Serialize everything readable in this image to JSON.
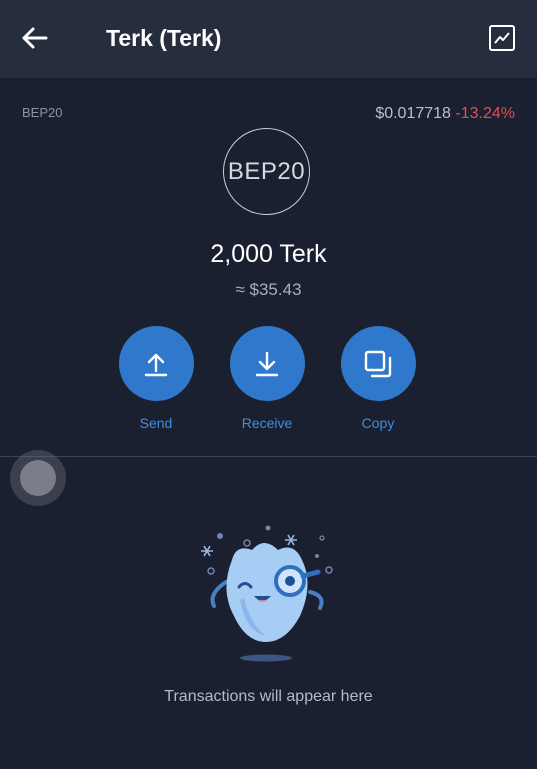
{
  "header": {
    "title": "Terk (Terk)",
    "back_icon": "arrow-left-icon",
    "chart_icon": "line-chart-icon"
  },
  "token": {
    "network": "BEP20",
    "logo_text": "BEP20",
    "price": "$0.017718",
    "change": "-13.24%",
    "balance": "2,000 Terk",
    "fiat_value": "≈ $35.43"
  },
  "actions": {
    "send": {
      "label": "Send",
      "icon": "upload-arrow-icon"
    },
    "receive": {
      "label": "Receive",
      "icon": "download-arrow-icon"
    },
    "copy": {
      "label": "Copy",
      "icon": "copy-icon"
    }
  },
  "transactions": {
    "empty_message": "Transactions will appear here",
    "illustration": "mascot-with-magnifier"
  },
  "colors": {
    "background": "#1b2030",
    "header": "#262d3d",
    "accent": "#2f78cc",
    "accent_text": "#3e8ee0",
    "negative": "#e05050"
  }
}
